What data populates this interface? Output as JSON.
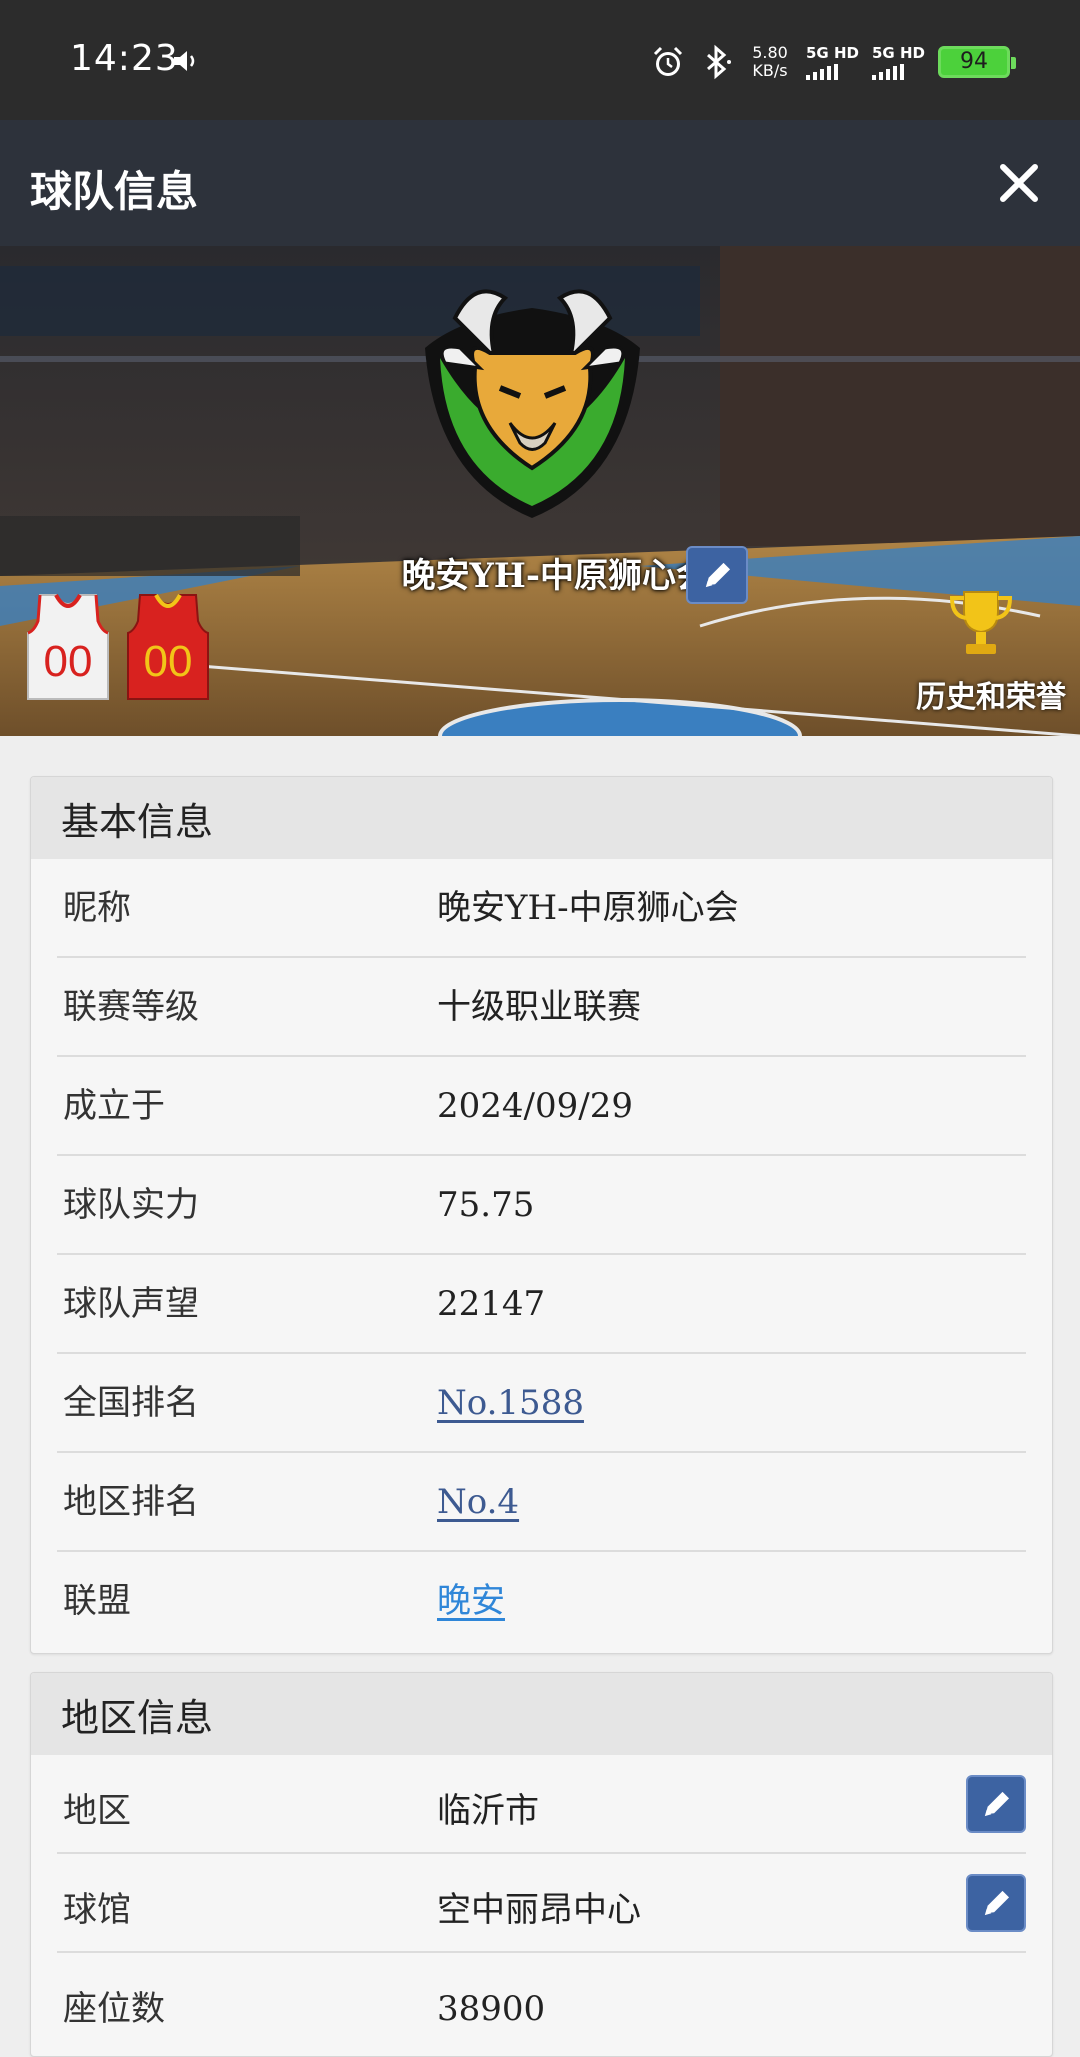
{
  "status_bar": {
    "time": "14:23",
    "speed_value": "5.80",
    "speed_unit": "KB/s",
    "sim1": "5G HD",
    "sim2": "5G HD",
    "battery": "94"
  },
  "header": {
    "title": "球队信息",
    "close_icon": "close-icon"
  },
  "banner": {
    "team_name": "晚安YH-中原狮心会",
    "jersey_home_number": "00",
    "jersey_away_number": "00",
    "honor_label": "历史和荣誉",
    "colors": {
      "home_jersey": "#f2f2f2",
      "away_jersey": "#d8221f",
      "accent": "#f2c418"
    }
  },
  "basic_info": {
    "title": "基本信息",
    "rows": [
      {
        "label": "昵称",
        "value": "晚安YH-中原狮心会"
      },
      {
        "label": "联赛等级",
        "value": "十级职业联赛"
      },
      {
        "label": "成立于",
        "value": "2024/09/29"
      },
      {
        "label": "球队实力",
        "value": "75.75"
      },
      {
        "label": "球队声望",
        "value": "22147"
      },
      {
        "label": "全国排名",
        "value": "No.1588"
      },
      {
        "label": "地区排名",
        "value": "No.4"
      },
      {
        "label": "联盟",
        "value": "晚安"
      }
    ]
  },
  "region_info": {
    "title": "地区信息",
    "rows": [
      {
        "label": "地区",
        "value": "临沂市"
      },
      {
        "label": "球馆",
        "value": "空中丽昂中心"
      },
      {
        "label": "座位数",
        "value": "38900"
      }
    ]
  },
  "colors": {
    "header_bg": "#2d323b",
    "link": "#3d5a91",
    "alliance_link": "#2f86d8",
    "edit_button": "#3d63a2"
  }
}
